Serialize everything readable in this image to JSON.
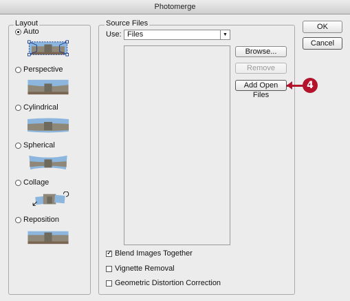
{
  "window": {
    "title": "Photomerge"
  },
  "layout": {
    "legend": "Layout",
    "options": [
      {
        "label": "Auto",
        "selected": true
      },
      {
        "label": "Perspective",
        "selected": false
      },
      {
        "label": "Cylindrical",
        "selected": false
      },
      {
        "label": "Spherical",
        "selected": false
      },
      {
        "label": "Collage",
        "selected": false
      },
      {
        "label": "Reposition",
        "selected": false
      }
    ]
  },
  "source_files": {
    "legend": "Source Files",
    "use_label": "Use:",
    "use_value": "Files",
    "buttons": {
      "browse": "Browse...",
      "remove": "Remove",
      "add_open_files": "Add Open Files"
    },
    "checkboxes": [
      {
        "label": "Blend Images Together",
        "checked": true
      },
      {
        "label": "Vignette Removal",
        "checked": false
      },
      {
        "label": "Geometric Distortion Correction",
        "checked": false
      }
    ]
  },
  "dialog_buttons": {
    "ok": "OK",
    "cancel": "Cancel"
  },
  "callout": {
    "number": "4",
    "color": "#b3132b"
  }
}
